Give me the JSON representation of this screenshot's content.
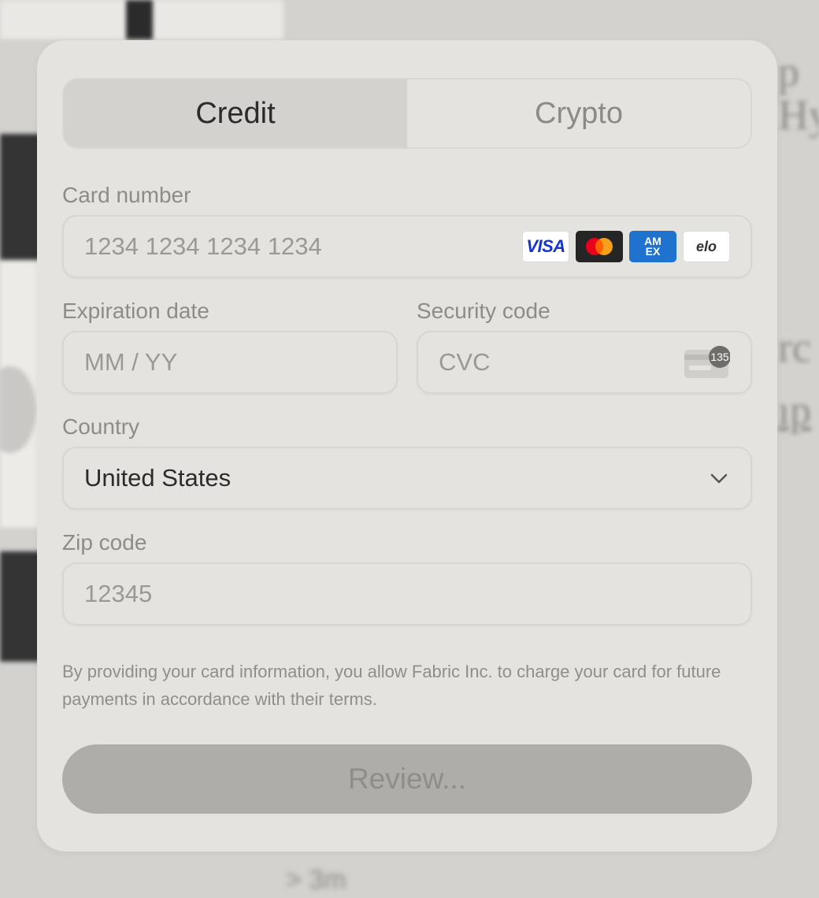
{
  "tabs": [
    {
      "label": "Credit",
      "active": true
    },
    {
      "label": "Crypto",
      "active": false
    }
  ],
  "card_number": {
    "label": "Card number",
    "placeholder": "1234 1234 1234 1234",
    "brands": [
      {
        "name": "visa-logo",
        "text": "VISA"
      },
      {
        "name": "mastercard-logo",
        "text": ""
      },
      {
        "name": "amex-logo",
        "text": "AM EX"
      },
      {
        "name": "elo-logo",
        "text": "elo"
      }
    ]
  },
  "expiration": {
    "label": "Expiration date",
    "placeholder": "MM / YY"
  },
  "security": {
    "label": "Security code",
    "placeholder": "CVC",
    "icon_badge": "135"
  },
  "country": {
    "label": "Country",
    "value": "United States"
  },
  "zip": {
    "label": "Zip code",
    "placeholder": "12345"
  },
  "disclaimer": "By providing your card information, you allow Fabric Inc. to charge your card for future payments in accordance with their terms.",
  "review_button": "Review...",
  "background": {
    "footer_text": "> 3m"
  },
  "colors": {
    "card_bg": "#e4e3df",
    "active_tab_bg": "#d3d2ce",
    "button_bg": "#aeadaa",
    "visa_blue": "#1434cb",
    "amex_blue": "#1f72cd"
  }
}
